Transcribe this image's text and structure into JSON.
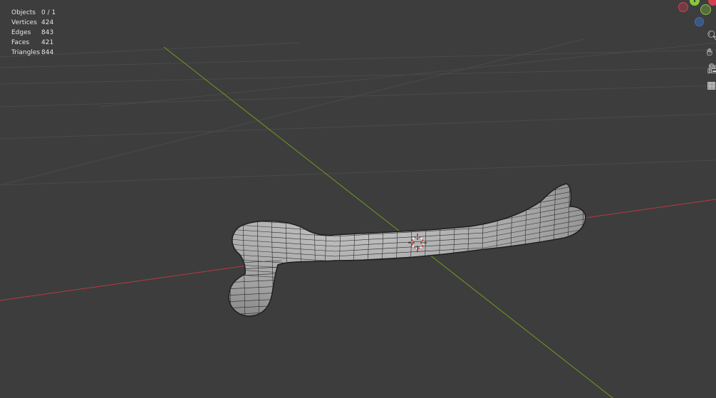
{
  "stats": [
    {
      "label": "Objects",
      "value": "0 / 1"
    },
    {
      "label": "Vertices",
      "value": "424"
    },
    {
      "label": "Edges",
      "value": "843"
    },
    {
      "label": "Faces",
      "value": "421"
    },
    {
      "label": "Triangles",
      "value": "844"
    }
  ],
  "colors": {
    "background": "#3d3d3d",
    "grid": "#4a4a4a",
    "x_axis": "#b83a3f",
    "y_axis": "#6e9a22",
    "mesh_fill": "#9a9a9a",
    "mesh_wire": "#262626",
    "gizmo_x": "#d3404f",
    "gizmo_y": "#8ac53f",
    "gizmo_z": "#3b70c4"
  },
  "gizmo": {
    "y_label": "Y"
  },
  "nav_icons": [
    "zoom-icon",
    "pan-hand-icon",
    "camera-icon",
    "grid-view-icon"
  ]
}
